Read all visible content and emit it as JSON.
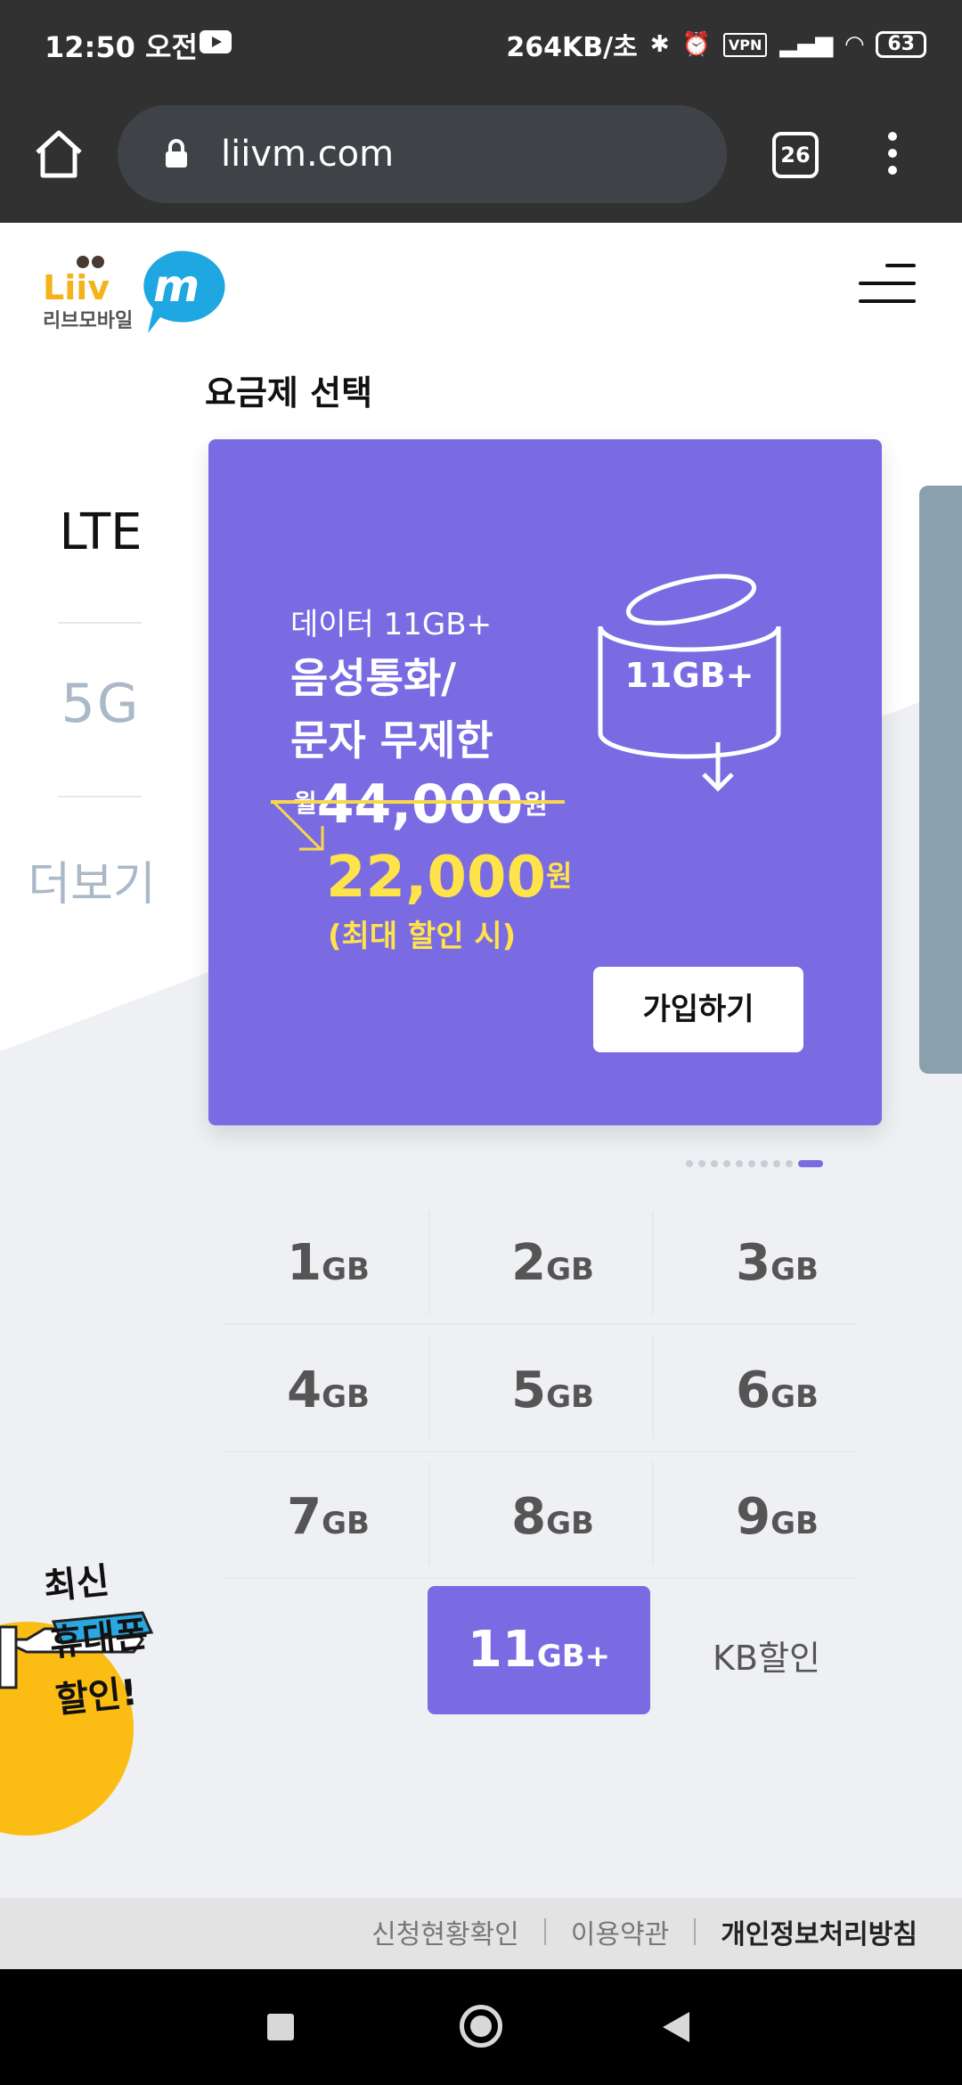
{
  "status_bar": {
    "time": "12:50 오전",
    "net_speed": "264KB/초",
    "vpn": "VPN",
    "battery": "63"
  },
  "browser": {
    "url": "liivm.com",
    "tab_count": "26"
  },
  "header": {
    "logo_text": "Liiv m",
    "logo_caption": "리브모바일"
  },
  "section_title": "요금제 선택",
  "side_tabs": [
    "LTE",
    "5G",
    "더보기"
  ],
  "card": {
    "data_line": "데이터 11GB+",
    "voice_line": "음성통화/",
    "sms_line": "문자 무제한",
    "won_prefix": "월",
    "original_price": "44,000",
    "won_unit": "원",
    "discount_price": "22,000",
    "discount_note": "(최대 할인 시)",
    "badge": "11GB+",
    "join_button": "가입하기",
    "accent_color": "#7b6be2"
  },
  "pagination": {
    "count": 10,
    "active_index": 9
  },
  "data_options": [
    {
      "n": "1",
      "u": "GB"
    },
    {
      "n": "2",
      "u": "GB"
    },
    {
      "n": "3",
      "u": "GB"
    },
    {
      "n": "4",
      "u": "GB"
    },
    {
      "n": "5",
      "u": "GB"
    },
    {
      "n": "6",
      "u": "GB"
    },
    {
      "n": "7",
      "u": "GB"
    },
    {
      "n": "8",
      "u": "GB"
    },
    {
      "n": "9",
      "u": "GB"
    },
    {
      "n": "11",
      "u": "GB+",
      "selected": true
    }
  ],
  "kb_discount_label": "KB할인",
  "promo": {
    "line1": "최신",
    "line2": "휴대폰",
    "line3": "할인!"
  },
  "footer": {
    "link1": "신청현황확인",
    "link2": "이용약관",
    "link3": "개인정보처리방침"
  }
}
